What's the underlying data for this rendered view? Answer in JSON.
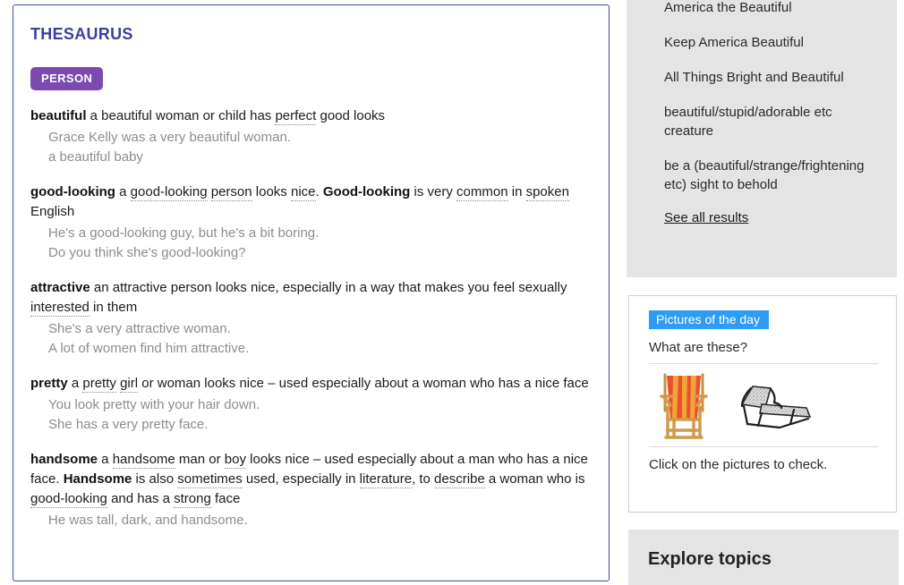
{
  "thesaurus": {
    "title": "THESAURUS",
    "pos_badge": "PERSON",
    "entries": [
      {
        "headword": "beautiful",
        "definition_parts": [
          {
            "t": " a beautiful woman or child has ",
            "style": "plain"
          },
          {
            "t": "perfect",
            "style": "dotted"
          },
          {
            "t": " good looks",
            "style": "plain"
          }
        ],
        "examples": [
          "Grace Kelly was a very beautiful woman.",
          "a beautiful baby"
        ]
      },
      {
        "headword": "good-looking",
        "definition_parts": [
          {
            "t": " a ",
            "style": "plain"
          },
          {
            "t": "good-looking",
            "style": "dotted"
          },
          {
            "t": " ",
            "style": "plain"
          },
          {
            "t": "person",
            "style": "dotted"
          },
          {
            "t": " looks ",
            "style": "plain"
          },
          {
            "t": "nice",
            "style": "dotted"
          },
          {
            "t": ". ",
            "style": "plain"
          },
          {
            "t": "Good-looking",
            "style": "bold"
          },
          {
            "t": " is very ",
            "style": "plain"
          },
          {
            "t": "common",
            "style": "dotted"
          },
          {
            "t": " in ",
            "style": "plain"
          },
          {
            "t": "spoken",
            "style": "dotted"
          },
          {
            "t": " English",
            "style": "plain"
          }
        ],
        "examples": [
          "He's a good-looking guy, but he's a bit boring.",
          "Do you think she's good-looking?"
        ]
      },
      {
        "headword": "attractive",
        "definition_parts": [
          {
            "t": " an attractive person looks nice, especially in a way that makes you feel sexually ",
            "style": "plain"
          },
          {
            "t": "interested",
            "style": "dotted"
          },
          {
            "t": " in them",
            "style": "plain"
          }
        ],
        "examples": [
          "She's a very attractive woman.",
          "A lot of women find him attractive."
        ]
      },
      {
        "headword": "pretty",
        "definition_parts": [
          {
            "t": " a ",
            "style": "plain"
          },
          {
            "t": "pretty",
            "style": "dotted"
          },
          {
            "t": " ",
            "style": "plain"
          },
          {
            "t": "girl",
            "style": "dotted"
          },
          {
            "t": " or woman looks nice – used especially about a woman who has a nice face",
            "style": "plain"
          }
        ],
        "examples": [
          "You look pretty with your hair down.",
          "She has a very pretty face."
        ]
      },
      {
        "headword": "handsome",
        "definition_parts": [
          {
            "t": " a ",
            "style": "plain"
          },
          {
            "t": "handsome",
            "style": "dotted"
          },
          {
            "t": " man or ",
            "style": "plain"
          },
          {
            "t": "boy",
            "style": "dotted"
          },
          {
            "t": " looks nice – used especially about a man who has a nice face. ",
            "style": "plain"
          },
          {
            "t": "Handsome",
            "style": "bold"
          },
          {
            "t": " is also ",
            "style": "plain"
          },
          {
            "t": "sometimes",
            "style": "dotted"
          },
          {
            "t": " used, especially in ",
            "style": "plain"
          },
          {
            "t": "literature",
            "style": "dotted"
          },
          {
            "t": ", to ",
            "style": "plain"
          },
          {
            "t": "describe",
            "style": "dotted"
          },
          {
            "t": " a woman who is ",
            "style": "plain"
          },
          {
            "t": "good-looking",
            "style": "dotted"
          },
          {
            "t": " and has a ",
            "style": "plain"
          },
          {
            "t": "strong",
            "style": "dotted"
          },
          {
            "t": " face",
            "style": "plain"
          }
        ],
        "examples": [
          "He was tall, dark, and handsome."
        ]
      }
    ]
  },
  "results_panel": {
    "items": [
      "America the Beautiful",
      "Keep America Beautiful",
      "All Things Bright and Beautiful",
      "beautiful/stupid/adorable etc creature",
      "be a (beautiful/strange/frightening etc) sight to behold"
    ],
    "see_all_label": "See all results"
  },
  "pictures_of_the_day": {
    "badge": "Pictures of the day",
    "question": "What are these?",
    "caption": "Click on the pictures to check.",
    "images": [
      {
        "name": "deck-chair-image",
        "alt": "striped wooden deck chair"
      },
      {
        "name": "sun-lounger-image",
        "alt": "black framed sun lounger"
      }
    ]
  },
  "explore": {
    "title": "Explore topics"
  },
  "colors": {
    "thesaurus_title": "#3b3fa0",
    "panel_border": "#3b4a9c",
    "pos_badge_bg": "#7b4bb0",
    "potd_badge_bg": "#2e9bf5",
    "sidebar_bg": "#e4e4e4",
    "example_text": "#8d8d8d"
  }
}
